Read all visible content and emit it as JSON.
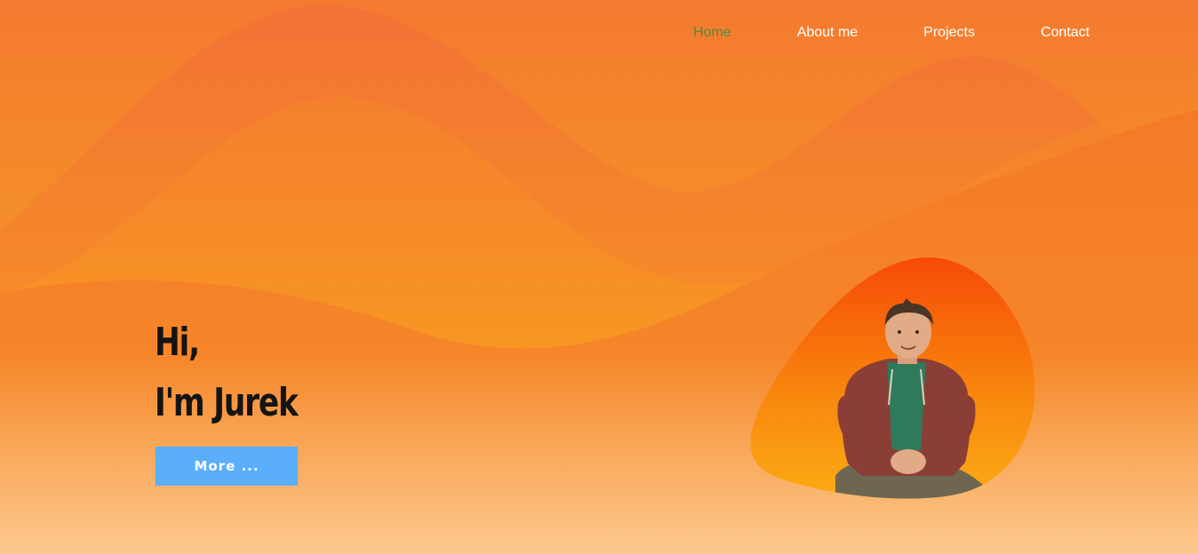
{
  "nav": {
    "items": [
      {
        "label": "Home",
        "active": true
      },
      {
        "label": "About me",
        "active": false
      },
      {
        "label": "Projects",
        "active": false
      },
      {
        "label": "Contact",
        "active": false
      }
    ]
  },
  "hero": {
    "greeting_line1": "Hi,",
    "greeting_line2": "I'm Jurek",
    "more_button_label": "More ..."
  },
  "colors": {
    "nav_active": "#4f8c3e",
    "button": "#5aaefc",
    "background_top": "#f47a30",
    "background_bottom": "#fdd09b"
  },
  "icons": {
    "portrait": "person-photo"
  }
}
